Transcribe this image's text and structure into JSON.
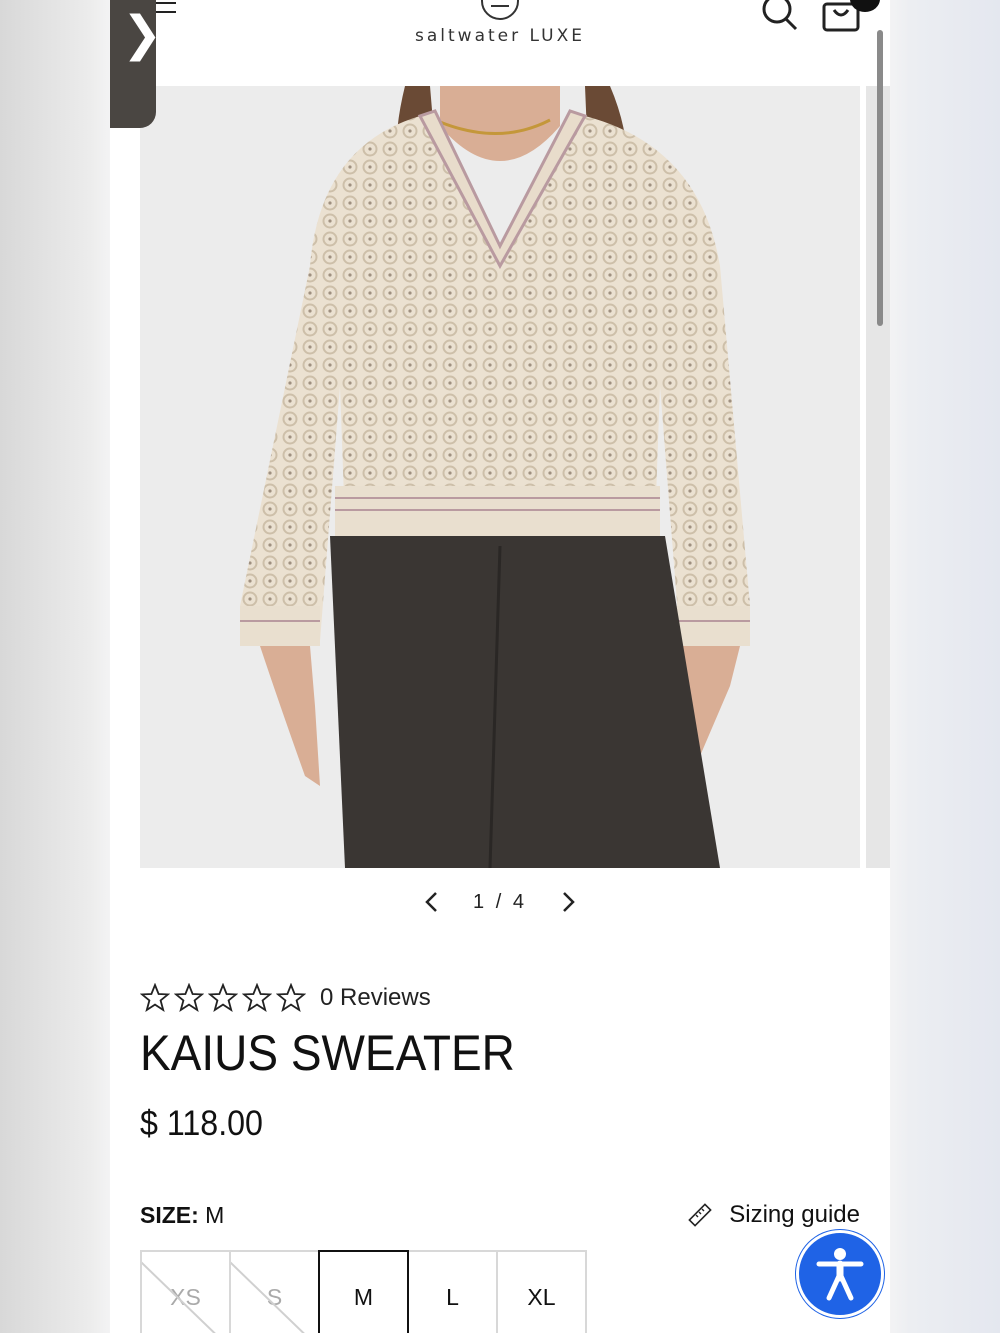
{
  "header": {
    "logo_text": "saltwater LUXE",
    "side_tab_glyph": "❯",
    "icons": [
      "hamburger-icon",
      "search-icon",
      "bag-icon",
      "logo-circle-icon"
    ]
  },
  "gallery": {
    "current": "1",
    "total": "4",
    "counter": "1 / 4"
  },
  "product": {
    "reviews": "0 Reviews",
    "rating": 0,
    "rating_max": 5,
    "title": "KAIUS SWEATER",
    "price": "$ 118.00",
    "size_label": "SIZE:",
    "size_value": "M",
    "sizing_guide": "Sizing guide",
    "sizes": [
      {
        "label": "XS",
        "available": false
      },
      {
        "label": "S",
        "available": false
      },
      {
        "label": "M",
        "available": true,
        "selected": true
      },
      {
        "label": "L",
        "available": true
      },
      {
        "label": "XL",
        "available": true
      }
    ]
  },
  "colors": {
    "accessibility_button": "#1f63e6",
    "side_tab": "#4a4642",
    "sweater": "#ebe1d1",
    "jeans": "#3a3633"
  }
}
